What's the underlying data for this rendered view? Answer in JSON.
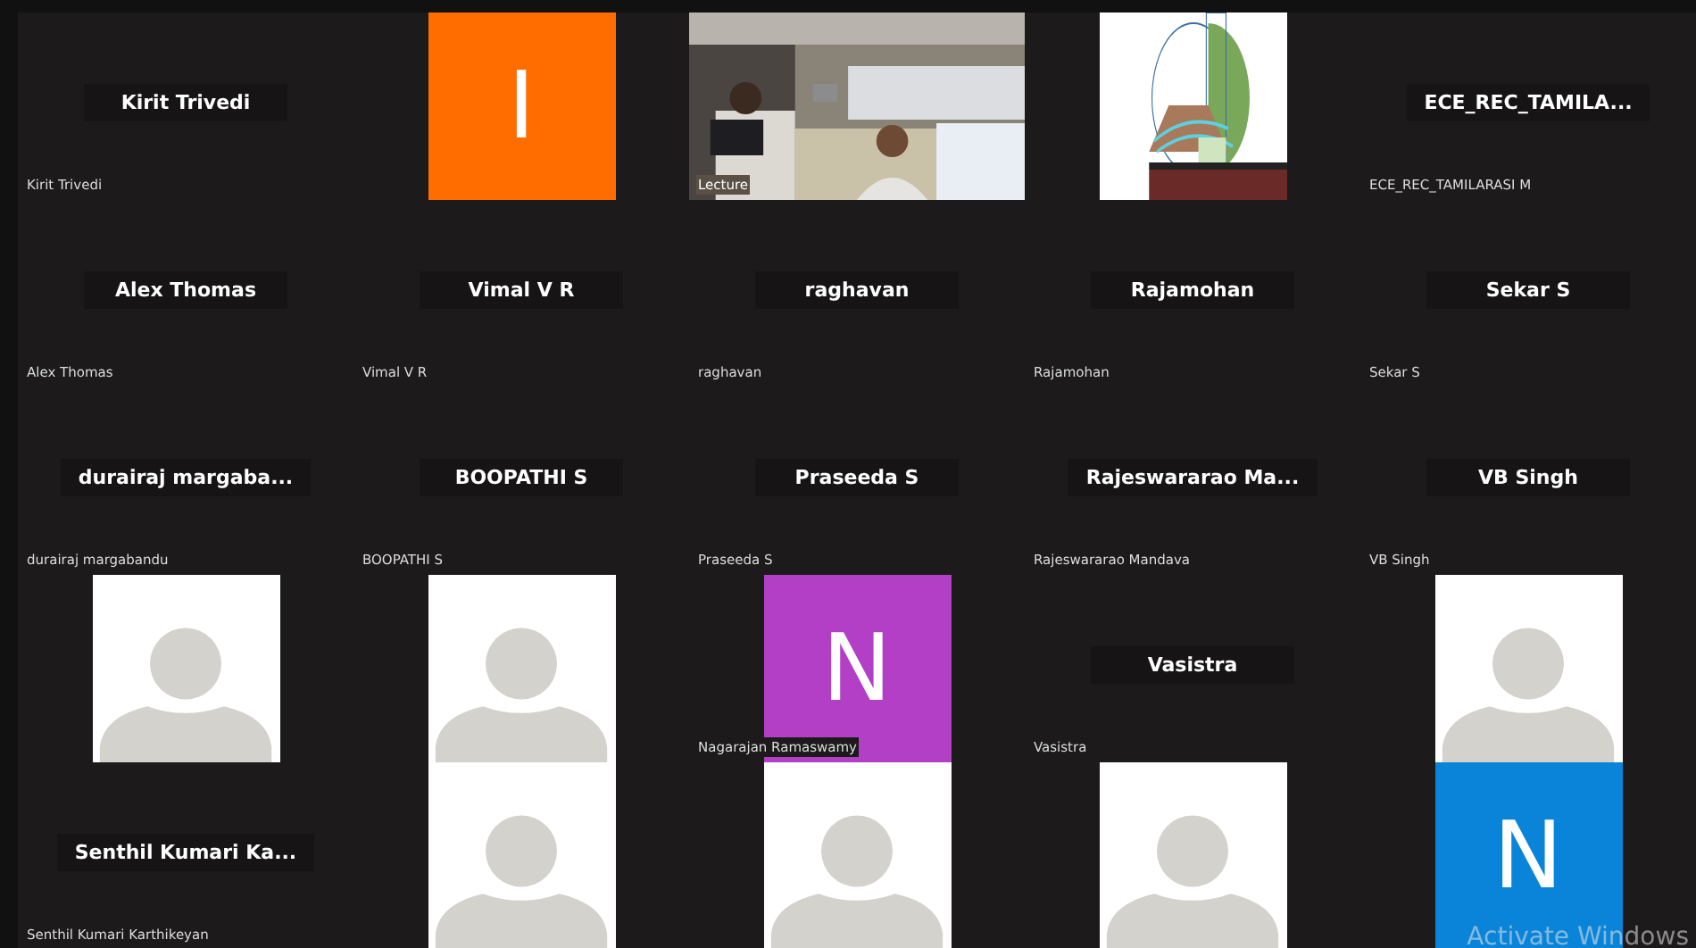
{
  "tiles": [
    {
      "kind": "name",
      "display": "Kirit Trivedi",
      "label": "Kirit Trivedi"
    },
    {
      "kind": "initial",
      "initial": "I",
      "color": "#ff6d00"
    },
    {
      "kind": "video",
      "label": "Lecture"
    },
    {
      "kind": "logo"
    },
    {
      "kind": "name",
      "display": "ECE_REC_TAMILA...",
      "label": "ECE_REC_TAMILARASI M"
    },
    {
      "kind": "name",
      "display": "Alex Thomas",
      "label": "Alex Thomas"
    },
    {
      "kind": "name",
      "display": "Vimal V R",
      "label": "Vimal V R"
    },
    {
      "kind": "name",
      "display": "raghavan",
      "label": "raghavan"
    },
    {
      "kind": "name",
      "display": "Rajamohan",
      "label": "Rajamohan"
    },
    {
      "kind": "name",
      "display": "Sekar S",
      "label": "Sekar S"
    },
    {
      "kind": "name",
      "display": "durairaj  margaba...",
      "label": "durairaj margabandu"
    },
    {
      "kind": "name",
      "display": "BOOPATHI S",
      "label": "BOOPATHI S"
    },
    {
      "kind": "name",
      "display": "Praseeda S",
      "label": "Praseeda S"
    },
    {
      "kind": "name",
      "display": "Rajeswararao  Ma...",
      "label": "Rajeswararao Mandava"
    },
    {
      "kind": "name",
      "display": "VB Singh",
      "label": "VB Singh"
    },
    {
      "kind": "placeholder"
    },
    {
      "kind": "placeholder"
    },
    {
      "kind": "initial",
      "initial": "N",
      "color": "#b23fc6",
      "label": "Nagarajan Ramaswamy"
    },
    {
      "kind": "name",
      "display": "Vasistra",
      "label": "Vasistra"
    },
    {
      "kind": "placeholder"
    },
    {
      "kind": "name",
      "display": "Senthil  Kumari  Ka...",
      "label": "Senthil Kumari Karthikeyan"
    },
    {
      "kind": "placeholder"
    },
    {
      "kind": "placeholder"
    },
    {
      "kind": "placeholder"
    },
    {
      "kind": "initial",
      "initial": "N",
      "color": "#0a84d8"
    }
  ],
  "system_overlay": {
    "text": "Activate Windows"
  }
}
